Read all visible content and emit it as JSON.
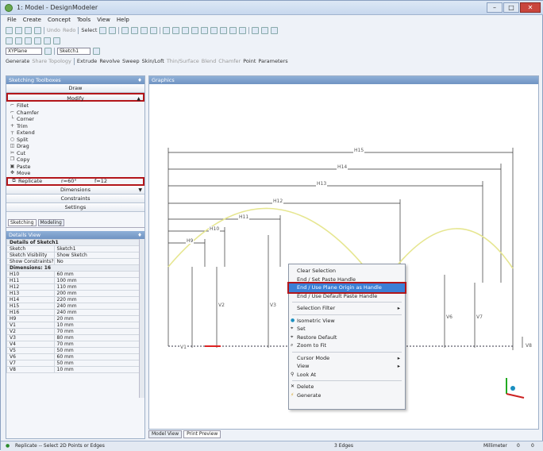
{
  "window": {
    "title": "1: Model - DesignModeler",
    "min": "–",
    "max": "□",
    "close": "✕"
  },
  "menu": [
    "File",
    "Create",
    "Concept",
    "Tools",
    "View",
    "Help"
  ],
  "toolbar1": {
    "undo": "Undo",
    "redo": "Redo",
    "select": "Select"
  },
  "toolbar3": {
    "plane": "XYPlane",
    "sketch": "Sketch1"
  },
  "toolbar4": {
    "generate": "Generate",
    "share": "Share Topology",
    "extrude": "Extrude",
    "revolve": "Revolve",
    "sweep": "Sweep",
    "skin": "Skin/Loft",
    "thin": "Thin/Surface",
    "blend": "Blend",
    "chamfer": "Chamfer",
    "point": "Point",
    "parameters": "Parameters"
  },
  "sketching": {
    "title": "Sketching Toolboxes",
    "draw": "Draw",
    "modify": "Modify",
    "tools": [
      "Fillet",
      "Chamfer",
      "Corner",
      "Trim",
      "Extend",
      "Split",
      "Drag",
      "Cut",
      "Copy",
      "Paste",
      "Move"
    ],
    "replicate": {
      "label": "Replicate",
      "r": "r=60°",
      "f": "f=12"
    },
    "dimensions": "Dimensions",
    "constraints": "Constraints",
    "settings": "Settings",
    "tabs": [
      "Sketching",
      "Modeling"
    ]
  },
  "details": {
    "title": "Details View",
    "group1": "Details of Sketch1",
    "rows1": [
      [
        "Sketch",
        "Sketch1"
      ],
      [
        "Sketch Visibility",
        "Show Sketch"
      ],
      [
        "Show Constraints?",
        "No"
      ]
    ],
    "group2": "Dimensions: 16",
    "rows2": [
      [
        "H10",
        "60 mm"
      ],
      [
        "H11",
        "100 mm"
      ],
      [
        "H12",
        "110 mm"
      ],
      [
        "H13",
        "200 mm"
      ],
      [
        "H14",
        "220 mm"
      ],
      [
        "H15",
        "240 mm"
      ],
      [
        "H16",
        "240 mm"
      ],
      [
        "H9",
        "20 mm"
      ],
      [
        "V1",
        "10 mm"
      ],
      [
        "V2",
        "70 mm"
      ],
      [
        "V3",
        "80 mm"
      ],
      [
        "V4",
        "70 mm"
      ],
      [
        "V5",
        "50 mm"
      ],
      [
        "V6",
        "60 mm"
      ],
      [
        "V7",
        "50 mm"
      ],
      [
        "V8",
        "10 mm"
      ]
    ]
  },
  "graphics": {
    "title": "Graphics",
    "dims": [
      "H15",
      "H14",
      "H13",
      "H12",
      "H11",
      "H10",
      "H9",
      "V1",
      "V2",
      "V3",
      "V6",
      "V7",
      "V8"
    ]
  },
  "context_menu": {
    "items": [
      "Clear Selection",
      "End / Set Paste Handle",
      "End / Use Plane Origin as Handle",
      "End / Use Default Paste Handle",
      "Selection Filter",
      "Isometric View",
      "Set",
      "Restore Default",
      "Zoom to Fit",
      "Cursor Mode",
      "View",
      "Look At",
      "Delete",
      "Generate"
    ]
  },
  "bottom_tabs": [
    "Model View",
    "Print Preview"
  ],
  "status": {
    "message": "Replicate -- Select 2D Points or Edges",
    "selection": "3 Edges",
    "units": "Millimeter",
    "a": "0",
    "b": "0"
  }
}
